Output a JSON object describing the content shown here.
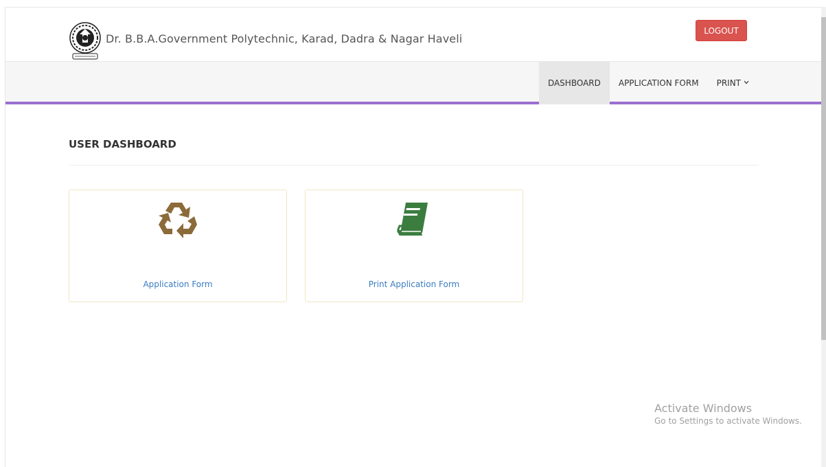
{
  "header": {
    "site_title": "Dr. B.B.A.Government Polytechnic, Karad, Dadra & Nagar Haveli",
    "logout_label": "LOGOUT"
  },
  "nav": {
    "items": [
      {
        "label": "DASHBOARD",
        "active": true
      },
      {
        "label": "APPLICATION FORM",
        "active": false
      },
      {
        "label": "PRINT",
        "active": false,
        "dropdown": true
      }
    ]
  },
  "main": {
    "section_title": "USER DASHBOARD",
    "cards": [
      {
        "label": "Application Form",
        "icon": "recycle-icon",
        "icon_color": "#8b6b3a"
      },
      {
        "label": "Print Application Form",
        "icon": "book-icon",
        "icon_color": "#3b7d3f"
      }
    ]
  },
  "watermark": {
    "line1": "Activate Windows",
    "line2": "Go to Settings to activate Windows."
  },
  "colors": {
    "accent": "#9a6fd1",
    "logout": "#d9534f",
    "link": "#3a7cc1"
  }
}
